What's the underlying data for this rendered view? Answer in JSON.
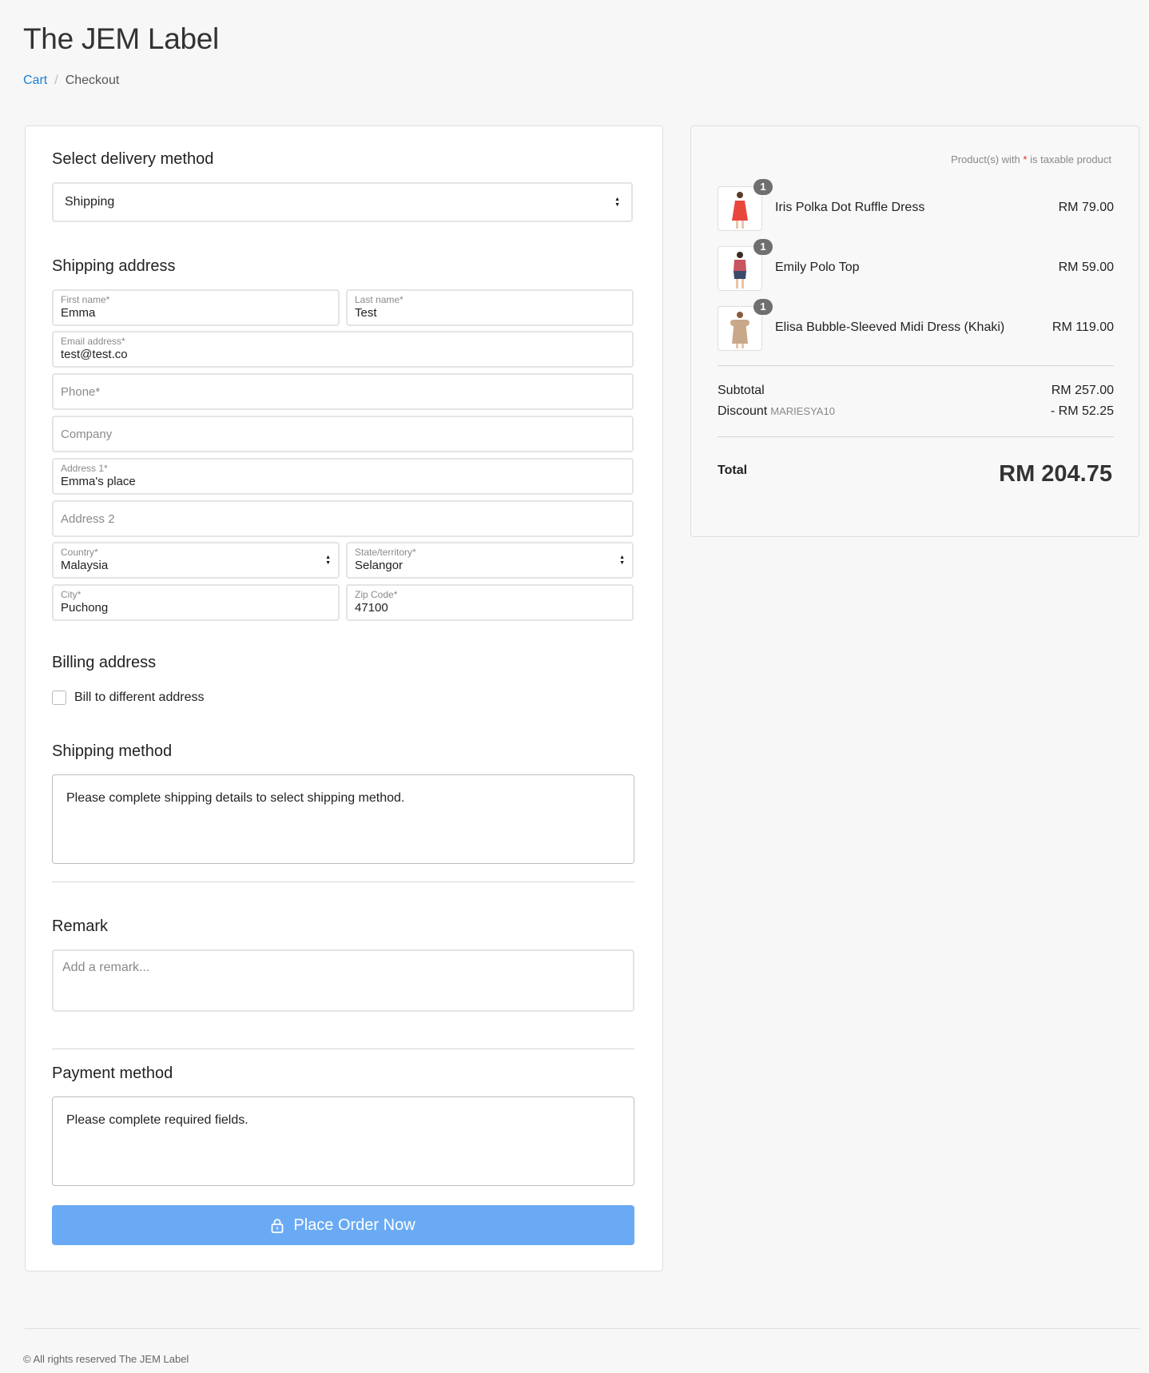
{
  "store": {
    "name": "The JEM Label"
  },
  "breadcrumb": {
    "cart": "Cart",
    "separator": "/",
    "current": "Checkout"
  },
  "delivery": {
    "heading": "Select delivery method",
    "selected": "Shipping"
  },
  "shipping_address": {
    "heading": "Shipping address",
    "first_name": {
      "label": "First name*",
      "value": "Emma"
    },
    "last_name": {
      "label": "Last name*",
      "value": "Test"
    },
    "email": {
      "label": "Email address*",
      "value": "test@test.co"
    },
    "phone": {
      "placeholder": "Phone*"
    },
    "company": {
      "placeholder": "Company"
    },
    "address1": {
      "label": "Address 1*",
      "value": "Emma's place"
    },
    "address2": {
      "placeholder": "Address 2"
    },
    "country": {
      "label": "Country*",
      "value": "Malaysia"
    },
    "state": {
      "label": "State/territory*",
      "value": "Selangor"
    },
    "city": {
      "label": "City*",
      "value": "Puchong"
    },
    "zip": {
      "label": "Zip Code*",
      "value": "47100"
    }
  },
  "billing": {
    "heading": "Billing address",
    "checkbox_label": "Bill to different address"
  },
  "shipping_method": {
    "heading": "Shipping method",
    "message": "Please complete shipping details to select shipping method."
  },
  "remark": {
    "heading": "Remark",
    "placeholder": "Add a remark..."
  },
  "payment": {
    "heading": "Payment method",
    "message": "Please complete required fields."
  },
  "place_order": {
    "label": "Place Order Now",
    "color": "#6aaaf4"
  },
  "summary": {
    "tax_note_prefix": "Product(s) with",
    "tax_note_star": "*",
    "tax_note_suffix": "is taxable product",
    "items": [
      {
        "quantity": "1",
        "name": "Iris Polka Dot Ruffle Dress",
        "price": "RM 79.00",
        "color": "#e8463d"
      },
      {
        "quantity": "1",
        "name": "Emily Polo Top",
        "price": "RM 59.00",
        "color": "#c9545f"
      },
      {
        "quantity": "1",
        "name": "Elisa Bubble-Sleeved Midi Dress (Khaki)",
        "price": "RM 119.00",
        "color": "#c9a88a"
      }
    ],
    "subtotal_label": "Subtotal",
    "subtotal_value": "RM 257.00",
    "discount_label": "Discount",
    "discount_code": "MARIESYA10",
    "discount_value": "- RM 52.25",
    "total_label": "Total",
    "total_value": "RM 204.75"
  },
  "footer": {
    "text": "© All rights reserved The JEM Label"
  }
}
